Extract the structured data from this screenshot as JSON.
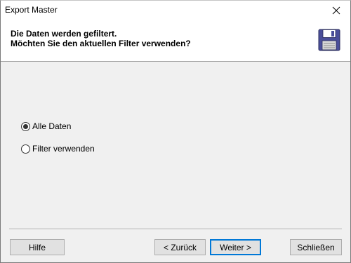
{
  "window": {
    "title": "Export Master"
  },
  "header": {
    "line1": "Die Daten werden gefiltert.",
    "line2": "Möchten Sie den aktuellen Filter verwenden?",
    "icon": "floppy-disk-icon"
  },
  "options": {
    "all_data": {
      "label": "Alle Daten",
      "selected": true
    },
    "use_filter": {
      "label": "Filter verwenden",
      "selected": false
    }
  },
  "buttons": {
    "help": "Hilfe",
    "back": "< Zurück",
    "next": "Weiter >",
    "close": "Schließen"
  },
  "colors": {
    "default_button_border": "#0078d7",
    "floppy_body": "#4a4e9a"
  }
}
